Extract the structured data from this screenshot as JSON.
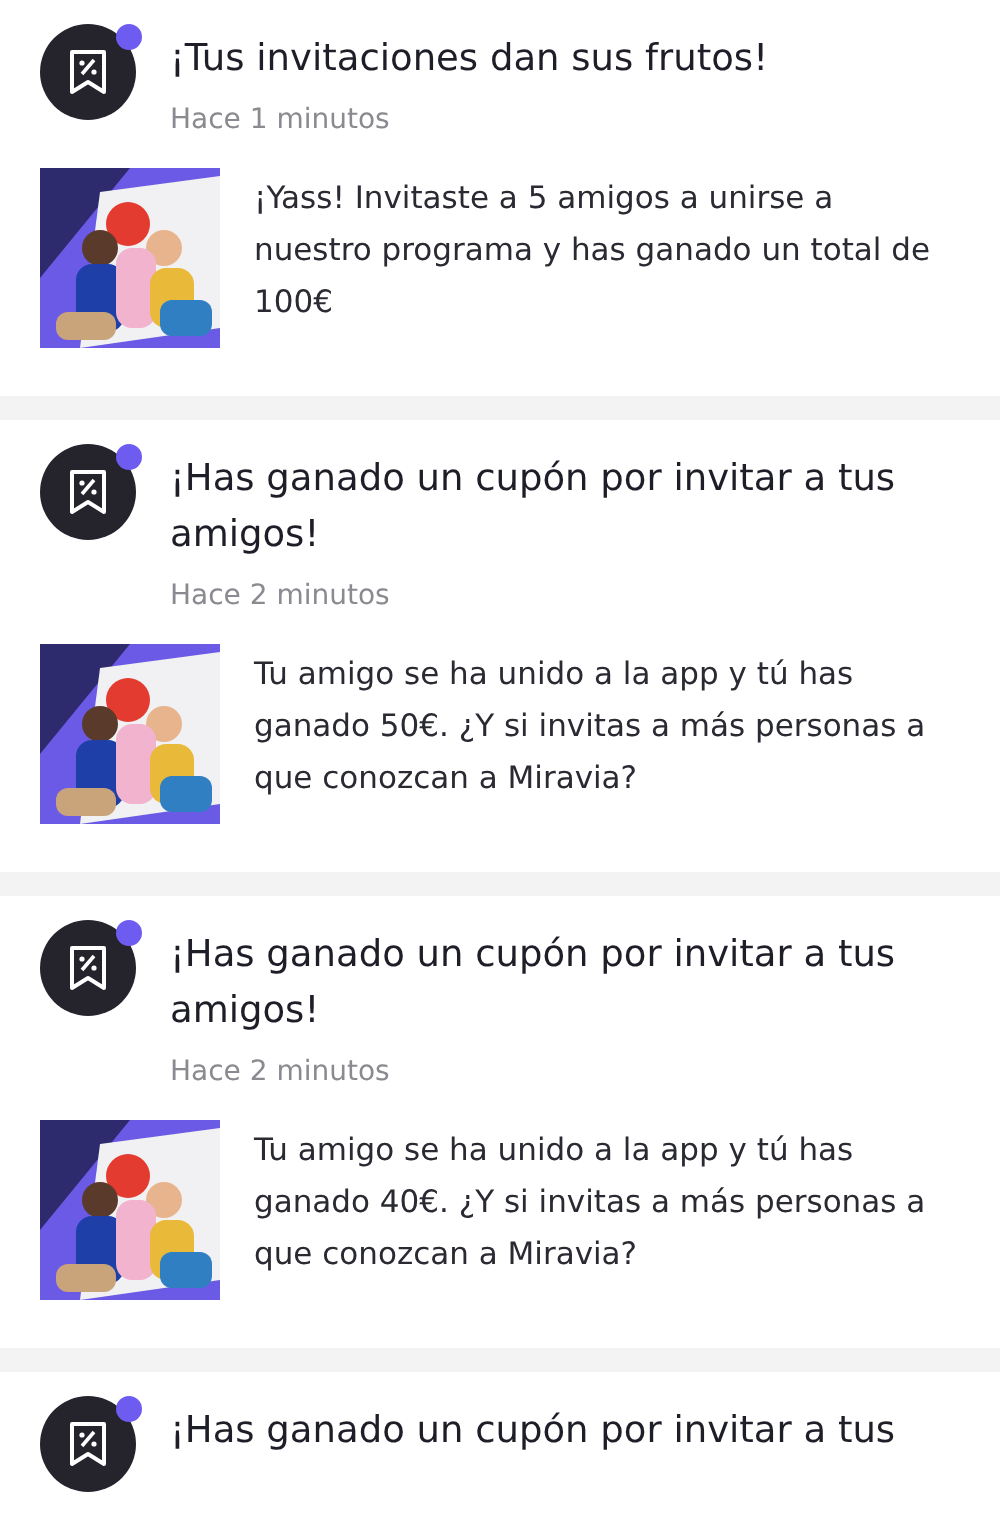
{
  "notifications": [
    {
      "title": "¡Tus invitaciones dan sus frutos!",
      "time": "Hace 1 minutos",
      "message": "¡Yass! Invitaste a 5 amigos a unirse a nuestro programa y has ganado un total de 100€",
      "unread": true
    },
    {
      "title": "¡Has ganado un cupón por invitar a tus amigos!",
      "time": "Hace 2 minutos",
      "message": "Tu amigo se ha unido a la app y tú has ganado 50€. ¿Y si invitas a más personas a que conozcan a Miravia?",
      "unread": true
    },
    {
      "title": "¡Has ganado un cupón por invitar a tus amigos!",
      "time": "Hace 2 minutos",
      "message": "Tu amigo se ha unido a la app y tú has ganado 40€. ¿Y si invitas a más personas a que conozcan a Miravia?",
      "unread": true
    },
    {
      "title": "¡Has ganado un cupón por invitar a tus",
      "unread": true
    }
  ]
}
